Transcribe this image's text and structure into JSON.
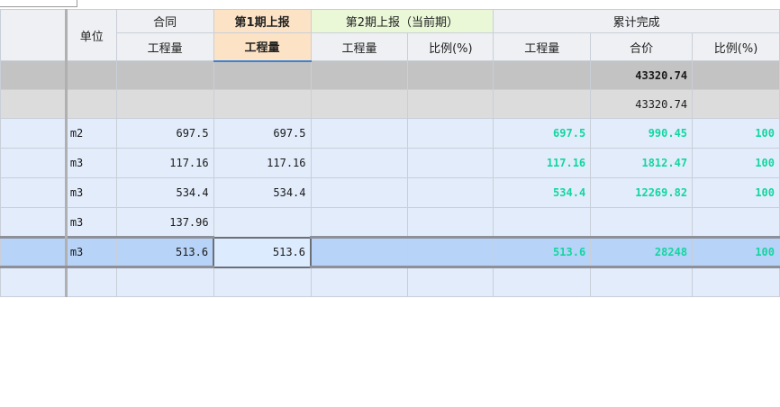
{
  "header": {
    "unit": "单位",
    "contract": "合同",
    "period1": "第1期上报",
    "period2": "第2期上报（当前期）",
    "cumulative": "累计完成",
    "qty": "工程量",
    "price": "合价",
    "ratio": "比例(%)"
  },
  "summary": {
    "row1_total": "43320.74",
    "row2_total": "43320.74"
  },
  "rows": [
    {
      "unit": "m2",
      "contract": "697.5",
      "p1": "697.5",
      "p2qty": "",
      "p2ratio": "",
      "cqty": "697.5",
      "cprice": "990.45",
      "cratio": "100"
    },
    {
      "unit": "m3",
      "contract": "117.16",
      "p1": "117.16",
      "p2qty": "",
      "p2ratio": "",
      "cqty": "117.16",
      "cprice": "1812.47",
      "cratio": "100"
    },
    {
      "unit": "m3",
      "contract": "534.4",
      "p1": "534.4",
      "p2qty": "",
      "p2ratio": "",
      "cqty": "534.4",
      "cprice": "12269.82",
      "cratio": "100"
    },
    {
      "unit": "m3",
      "contract": "137.96",
      "p1": "",
      "p2qty": "",
      "p2ratio": "",
      "cqty": "",
      "cprice": "",
      "cratio": ""
    },
    {
      "unit": "m3",
      "contract": "513.6",
      "p1": "513.6",
      "p2qty": "",
      "p2ratio": "",
      "cqty": "513.6",
      "cprice": "28248",
      "cratio": "100"
    },
    {
      "unit": "",
      "contract": "",
      "p1": "",
      "p2qty": "",
      "p2ratio": "",
      "cqty": "",
      "cprice": "",
      "cratio": ""
    }
  ]
}
